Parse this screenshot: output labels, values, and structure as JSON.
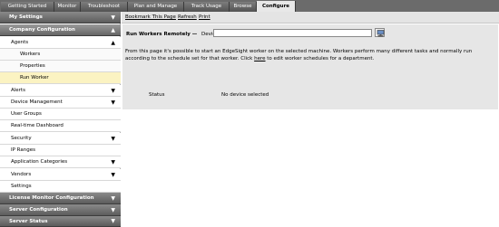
{
  "tabs": [
    {
      "label": "Getting Started"
    },
    {
      "label": "Monitor"
    },
    {
      "label": "Troubleshoot"
    },
    {
      "label": "Plan and Manage"
    },
    {
      "label": "Track Usage"
    },
    {
      "label": "Browse"
    },
    {
      "label": "Configure",
      "active": true
    }
  ],
  "sidebar": {
    "my_settings": "My Settings",
    "company_configuration": "Company Configuration",
    "agents": "Agents",
    "workers": "Workers",
    "properties": "Properties",
    "run_worker": "Run Worker",
    "alerts": "Alerts",
    "device_management": "Device Management",
    "user_groups": "User Groups",
    "real_time_dashboard": "Real-time Dashboard",
    "security": "Security",
    "ip_ranges": "IP Ranges",
    "application_categories": "Application Categories",
    "vendors": "Vendors",
    "settings": "Settings",
    "license_monitor_configuration": "License Monitor Configuration",
    "server_configuration": "Server Configuration",
    "server_status": "Server Status"
  },
  "toolbar": {
    "bookmark": "Bookmark This Page",
    "refresh": "Refresh",
    "print": "Print"
  },
  "run_worker": {
    "title": "Run Workers Remotely —",
    "device_label": "Device:",
    "device_value": "",
    "description_before": "From this page it's possible to start an EdgeSight worker on the selected machine. Workers perform many different tasks and normally run according to the schedule set for that worker. Click ",
    "description_link": "here",
    "description_after": " to edit worker schedules for a department.",
    "status_label": "Status",
    "status_value": "No device selected"
  }
}
